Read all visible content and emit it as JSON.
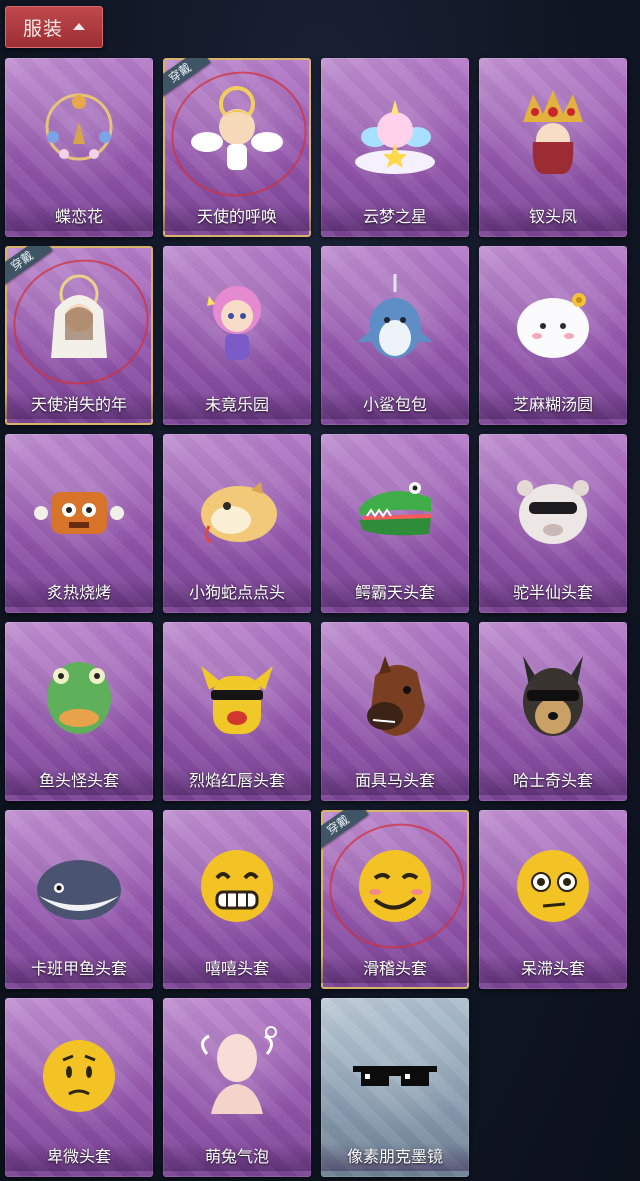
{
  "header": {
    "title": "服装"
  },
  "worn_badge_text": "穿戴",
  "items": [
    {
      "name": "蝶恋花",
      "worn": false,
      "icon": "flower-wreath-icon"
    },
    {
      "name": "天使的呼唤",
      "worn": true,
      "icon": "angel-icon"
    },
    {
      "name": "云梦之星",
      "worn": false,
      "icon": "unicorn-cloud-icon"
    },
    {
      "name": "钗头凤",
      "worn": false,
      "icon": "phoenix-crown-icon"
    },
    {
      "name": "天使消失的年",
      "worn": true,
      "icon": "veiled-angel-icon"
    },
    {
      "name": "未竟乐园",
      "worn": false,
      "icon": "pink-hair-girl-icon"
    },
    {
      "name": "小鲨包包",
      "worn": false,
      "icon": "shark-bag-icon"
    },
    {
      "name": "芝麻糊汤圆",
      "worn": false,
      "icon": "dumpling-icon"
    },
    {
      "name": "炙热烧烤",
      "worn": false,
      "icon": "bbq-meat-icon"
    },
    {
      "name": "小狗蛇点点头",
      "worn": false,
      "icon": "dog-snake-icon"
    },
    {
      "name": "鳄霸天头套",
      "worn": false,
      "icon": "crocodile-icon"
    },
    {
      "name": "驼半仙头套",
      "worn": false,
      "icon": "alpaca-icon"
    },
    {
      "name": "鱼头怪头套",
      "worn": false,
      "icon": "fish-head-icon"
    },
    {
      "name": "烈焰红唇头套",
      "worn": false,
      "icon": "red-lips-mask-icon"
    },
    {
      "name": "面具马头套",
      "worn": false,
      "icon": "horse-head-icon"
    },
    {
      "name": "哈士奇头套",
      "worn": false,
      "icon": "husky-icon"
    },
    {
      "name": "卡班甲鱼头套",
      "worn": false,
      "icon": "whale-head-icon"
    },
    {
      "name": "嘻嘻头套",
      "worn": false,
      "icon": "grin-emoji-icon"
    },
    {
      "name": "滑稽头套",
      "worn": true,
      "icon": "funny-emoji-icon"
    },
    {
      "name": "呆滞头套",
      "worn": false,
      "icon": "stunned-emoji-icon"
    },
    {
      "name": "卑微头套",
      "worn": false,
      "icon": "humble-emoji-icon"
    },
    {
      "name": "萌兔气泡",
      "worn": false,
      "icon": "bunny-bubble-icon"
    },
    {
      "name": "像素朋克墨镜",
      "worn": false,
      "icon": "pixel-sunglasses-icon",
      "special": true
    }
  ]
}
